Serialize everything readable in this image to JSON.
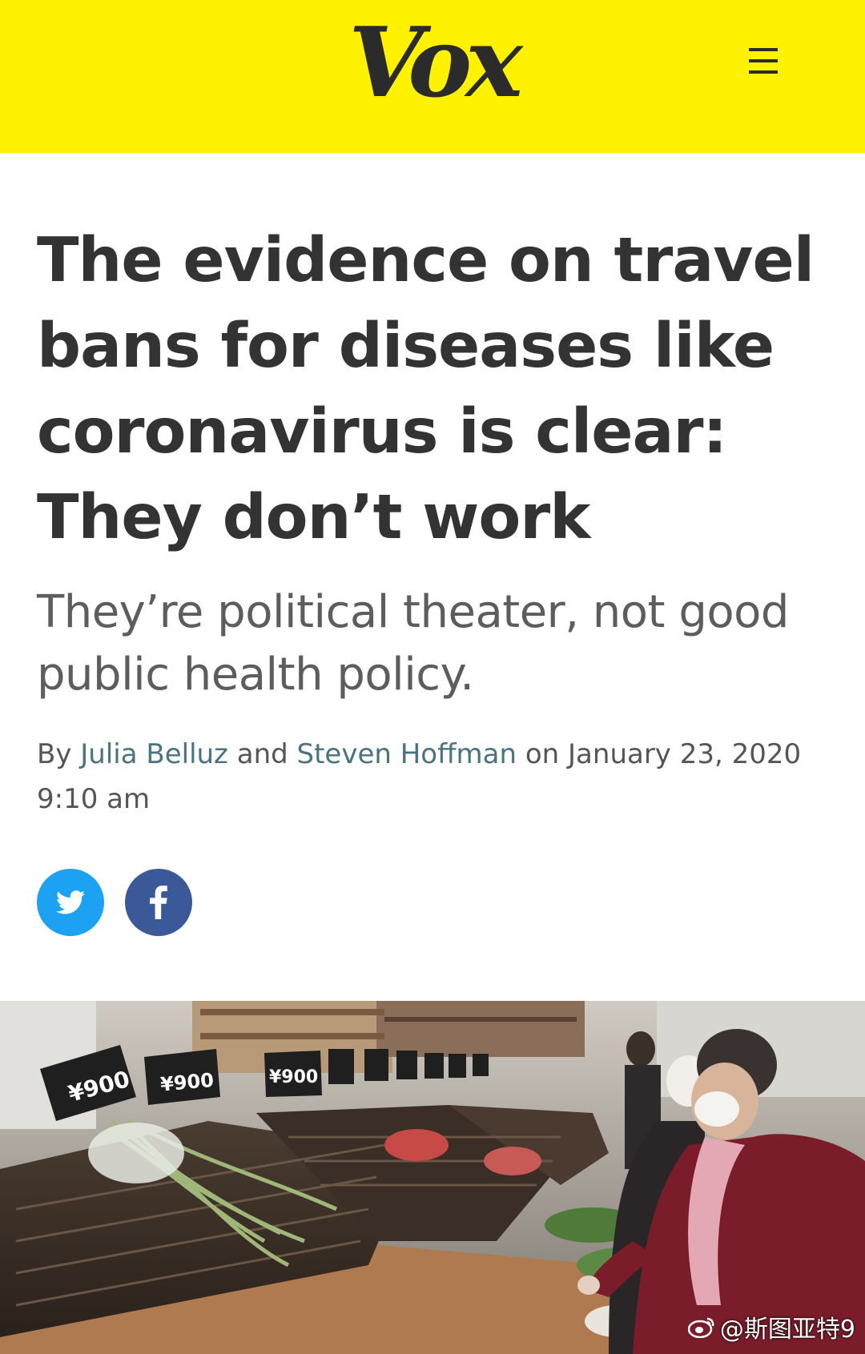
{
  "header": {
    "logo_text": "Vox",
    "background_color": "#fff200",
    "menu_icon": "hamburger-menu-icon"
  },
  "article": {
    "headline": "The evidence on travel bans for diseases like coronavirus is clear: They don’t work",
    "dek": "They’re political theater, not good public health policy.",
    "byline": {
      "prefix": "By",
      "author_1": "Julia Belluz",
      "conjunction": "and",
      "author_2": "Steven Hoffman",
      "date_prefix": "on",
      "date": "January 23, 2020",
      "time": "9:10 am"
    },
    "share": {
      "twitter_icon": "twitter-bird-icon",
      "twitter_color": "#1da1f2",
      "facebook_icon": "facebook-f-icon",
      "facebook_color": "#3b5998"
    },
    "hero_image": {
      "price_tags": [
        "¥900",
        "¥900",
        "¥900"
      ]
    }
  },
  "watermark": {
    "text": "@斯图亚特9",
    "icon": "weibo-logo-icon"
  }
}
